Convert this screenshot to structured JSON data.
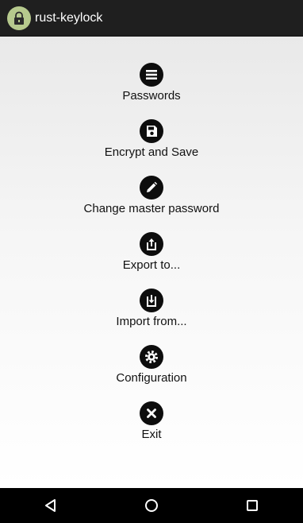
{
  "app_bar": {
    "title": "rust-keylock",
    "icon": "lock-icon"
  },
  "menu": [
    {
      "label": "Passwords",
      "icon": "list-icon"
    },
    {
      "label": "Encrypt and Save",
      "icon": "save-icon"
    },
    {
      "label": "Change master password",
      "icon": "pencil-icon"
    },
    {
      "label": "Export to...",
      "icon": "export-icon"
    },
    {
      "label": "Import from...",
      "icon": "import-icon"
    },
    {
      "label": "Configuration",
      "icon": "gear-icon"
    },
    {
      "label": "Exit",
      "icon": "close-icon"
    }
  ],
  "nav_bar": {
    "back": "back-icon",
    "home": "home-icon",
    "recents": "recents-icon"
  },
  "colors": {
    "app_bar": "#1f1f1f",
    "app_icon_bg": "#b6c98d",
    "menu_icon": "#0d0d0d",
    "nav_bar": "#000000"
  }
}
